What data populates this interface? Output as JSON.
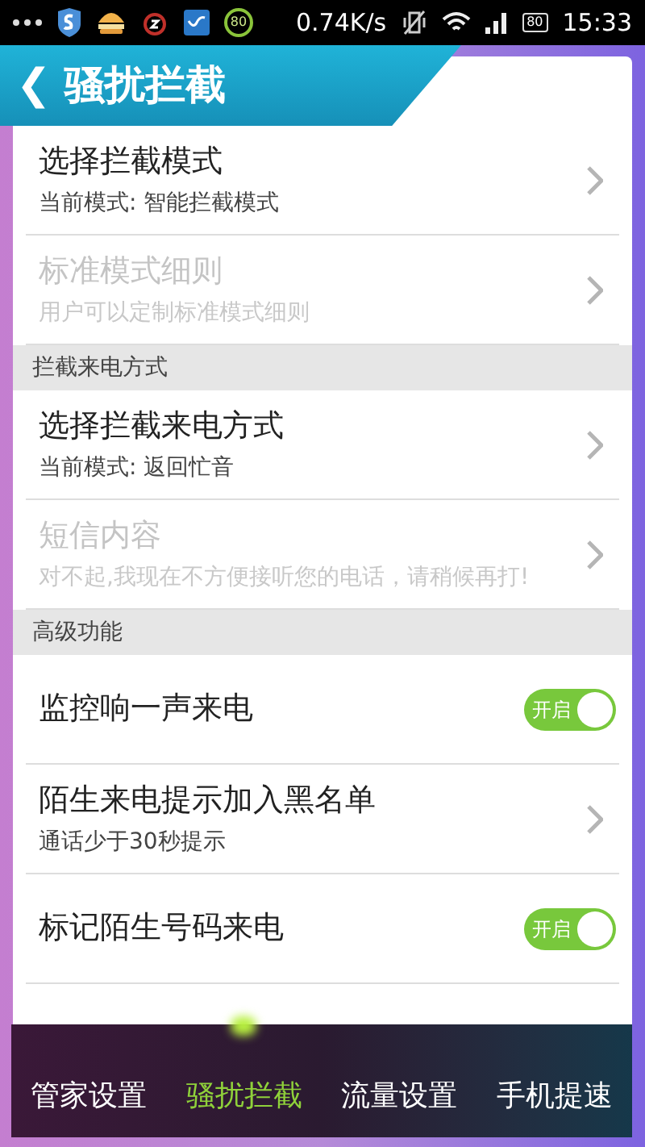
{
  "status_bar": {
    "notification_badge": "80",
    "speed": "0.74K/s",
    "battery": "80",
    "time": "15:33"
  },
  "header": {
    "back": "❮",
    "title": "骚扰拦截"
  },
  "sections": [
    {
      "items": [
        {
          "kind": "link",
          "title": "选择拦截模式",
          "subtitle": "当前模式: 智能拦截模式",
          "disabled": false
        },
        {
          "kind": "link",
          "title": "标准模式细则",
          "subtitle": "用户可以定制标准模式细则",
          "disabled": true
        }
      ]
    },
    {
      "header": "拦截来电方式",
      "items": [
        {
          "kind": "link",
          "title": "选择拦截来电方式",
          "subtitle": "当前模式: 返回忙音",
          "disabled": false
        },
        {
          "kind": "link",
          "title": "短信内容",
          "subtitle": "对不起,我现在不方便接听您的电话，请稍候再打!",
          "disabled": true
        }
      ]
    },
    {
      "header": "高级功能",
      "items": [
        {
          "kind": "toggle",
          "title": "监控响一声来电",
          "on": true,
          "toggle_label": "开启"
        },
        {
          "kind": "link",
          "title": "陌生来电提示加入黑名单",
          "subtitle": "通话少于30秒提示",
          "disabled": false
        },
        {
          "kind": "toggle",
          "title": "标记陌生号码来电",
          "on": true,
          "toggle_label": "开启"
        }
      ]
    }
  ],
  "bottom_tabs": [
    {
      "label": "管家设置",
      "selected": false
    },
    {
      "label": "骚扰拦截",
      "selected": true
    },
    {
      "label": "流量设置",
      "selected": false
    },
    {
      "label": "手机提速",
      "selected": false
    }
  ]
}
